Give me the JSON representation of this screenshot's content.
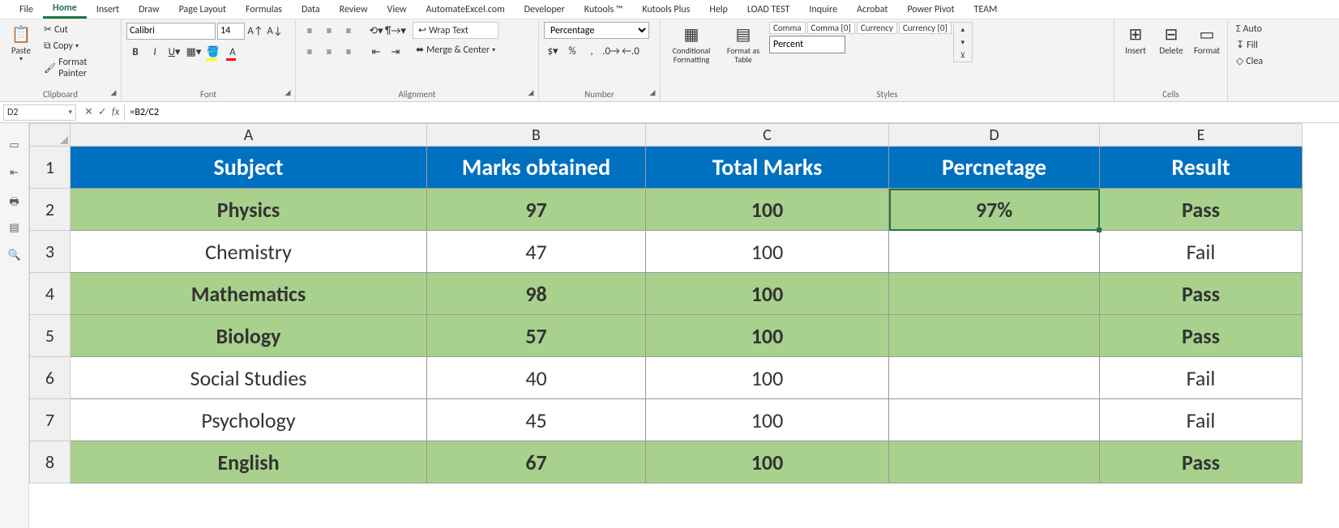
{
  "menu": {
    "tabs": [
      "File",
      "Home",
      "Insert",
      "Draw",
      "Page Layout",
      "Formulas",
      "Data",
      "Review",
      "View",
      "AutomateExcel.com",
      "Developer",
      "Kutools ™",
      "Kutools Plus",
      "Help",
      "LOAD TEST",
      "Inquire",
      "Acrobat",
      "Power Pivot",
      "TEAM"
    ],
    "active": "Home"
  },
  "ribbon": {
    "clipboard": {
      "paste": "Paste",
      "cut": "Cut",
      "copy": "Copy",
      "painter": "Format Painter",
      "label": "Clipboard"
    },
    "font": {
      "name": "Calibri",
      "size": "14",
      "label": "Font"
    },
    "alignment": {
      "wrap": "Wrap Text",
      "merge": "Merge & Center",
      "label": "Alignment"
    },
    "number": {
      "format": "Percentage",
      "label": "Number"
    },
    "styles": {
      "cond": "Conditional Formatting",
      "fmt_table": "Format as Table",
      "gallery": [
        "Comma",
        "Comma [0]",
        "Currency",
        "Currency [0]"
      ],
      "percent": "Percent",
      "label": "Styles"
    },
    "cells": {
      "insert": "Insert",
      "delete": "Delete",
      "format": "Format",
      "label": "Cells"
    },
    "editing": {
      "autosum": "Auto",
      "fill": "Fill",
      "clear": "Clea"
    }
  },
  "formula_bar": {
    "namebox": "D2",
    "fx": "fx",
    "formula": "=B2/C2"
  },
  "sheet": {
    "columns": [
      "A",
      "B",
      "C",
      "D",
      "E"
    ],
    "row_numbers": [
      "1",
      "2",
      "3",
      "4",
      "5",
      "6",
      "7",
      "8"
    ],
    "header": [
      "Subject",
      "Marks obtained",
      "Total Marks",
      "Percnetage",
      "Result"
    ],
    "rows": [
      {
        "cells": [
          "Physics",
          "97",
          "100",
          "97%",
          "Pass"
        ],
        "result": "pass"
      },
      {
        "cells": [
          "Chemistry",
          "47",
          "100",
          "",
          "Fail"
        ],
        "result": "fail"
      },
      {
        "cells": [
          "Mathematics",
          "98",
          "100",
          "",
          "Pass"
        ],
        "result": "pass"
      },
      {
        "cells": [
          "Biology",
          "57",
          "100",
          "",
          "Pass"
        ],
        "result": "pass"
      },
      {
        "cells": [
          "Social Studies",
          "40",
          "100",
          "",
          "Fail"
        ],
        "result": "fail"
      },
      {
        "cells": [
          "Psychology",
          "45",
          "100",
          "",
          "Fail"
        ],
        "result": "fail"
      },
      {
        "cells": [
          "English",
          "67",
          "100",
          "",
          "Pass"
        ],
        "result": "pass"
      }
    ],
    "selected": {
      "row": 0,
      "col": 3
    }
  }
}
